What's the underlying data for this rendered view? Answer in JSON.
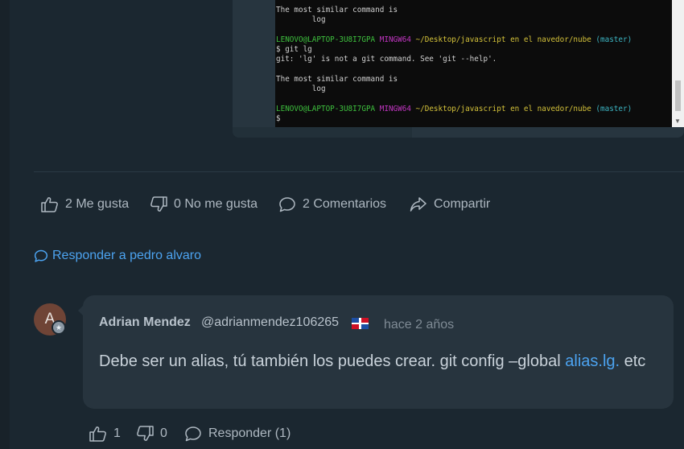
{
  "terminal": {
    "lines": [
      {
        "parts": [
          {
            "t": "The most similar command is",
            "c": ""
          }
        ]
      },
      {
        "parts": [
          {
            "t": "        log",
            "c": ""
          }
        ]
      },
      {
        "parts": [
          {
            "t": "",
            "c": ""
          }
        ]
      },
      {
        "parts": [
          {
            "t": "LENOVO@LAPTOP-3U8I7GPA ",
            "c": "t-green"
          },
          {
            "t": "MINGW64 ",
            "c": "t-magenta"
          },
          {
            "t": "~/Desktop/javascript en el navedor/nube ",
            "c": "t-yellow"
          },
          {
            "t": "(master)",
            "c": "t-cyan"
          }
        ]
      },
      {
        "parts": [
          {
            "t": "$ git lg",
            "c": ""
          }
        ]
      },
      {
        "parts": [
          {
            "t": "git: 'lg' is not a git command. See 'git --help'.",
            "c": ""
          }
        ]
      },
      {
        "parts": [
          {
            "t": "",
            "c": ""
          }
        ]
      },
      {
        "parts": [
          {
            "t": "The most similar command is",
            "c": ""
          }
        ]
      },
      {
        "parts": [
          {
            "t": "        log",
            "c": ""
          }
        ]
      },
      {
        "parts": [
          {
            "t": "",
            "c": ""
          }
        ]
      },
      {
        "parts": [
          {
            "t": "LENOVO@LAPTOP-3U8I7GPA ",
            "c": "t-green"
          },
          {
            "t": "MINGW64 ",
            "c": "t-magenta"
          },
          {
            "t": "~/Desktop/javascript en el navedor/nube ",
            "c": "t-yellow"
          },
          {
            "t": "(master)",
            "c": "t-cyan"
          }
        ]
      },
      {
        "parts": [
          {
            "t": "$",
            "c": ""
          }
        ]
      }
    ]
  },
  "post_actions": {
    "likes_label": "2 Me gusta",
    "dislikes_label": "0 No me gusta",
    "comments_label": "2 Comentarios",
    "share_label": "Compartir"
  },
  "reply_link": {
    "label": "Responder a pedro alvaro"
  },
  "comment": {
    "avatar_initial": "A",
    "author": "Adrian Mendez",
    "handle": "@adrianmendez106265",
    "time": "hace 2 años",
    "text_before": "Debe ser un alias, tú también los puedes crear. git config –global ",
    "link_text": "alias.lg.",
    "text_after": " etc",
    "likes": "1",
    "dislikes": "0",
    "reply_label": "Responder (1)"
  },
  "colors": {
    "background": "#1b2730",
    "bubble": "#27343e",
    "link": "#4ca3f0",
    "terminal_bg": "#0c0c0c"
  },
  "icons": [
    "thumbs-up-icon",
    "thumbs-down-icon",
    "comment-icon",
    "share-icon",
    "flag-dominican-republic-icon",
    "star-badge-icon"
  ]
}
